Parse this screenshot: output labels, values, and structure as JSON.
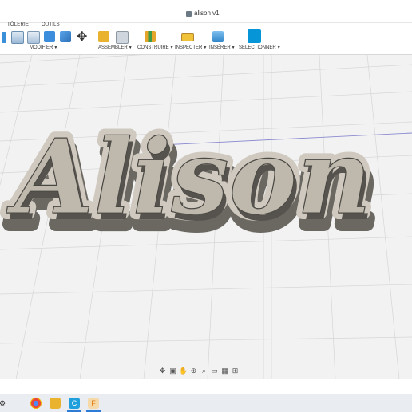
{
  "window": {
    "title": "alison v1"
  },
  "tabs": [
    "TÔLERIE",
    "OUTILS"
  ],
  "toolbar_groups": [
    {
      "label": "MODIFIER"
    },
    {
      "label": "ASSEMBLER"
    },
    {
      "label": "CONSTRUIRE"
    },
    {
      "label": "INSPECTER"
    },
    {
      "label": "INSÉRER"
    },
    {
      "label": "SÉLECTIONNER"
    }
  ],
  "model": {
    "text": "Alison"
  },
  "colors": {
    "accent": "#0696d7",
    "model_top": "#cfc9bf",
    "model_side": "#6b6862",
    "grid_line": "#d6d6d6",
    "axis_line": "#8a8ad0"
  },
  "nav_icons": [
    "orbit-icon",
    "look-at-icon",
    "pan-hand-icon",
    "zoom-window-icon",
    "zoom-icon",
    "display-settings-icon",
    "visual-style-icon",
    "grid-settings-icon"
  ],
  "taskbar_icons": [
    "chrome-icon",
    "file-explorer-icon",
    "app-c-icon",
    "fusion-icon"
  ]
}
